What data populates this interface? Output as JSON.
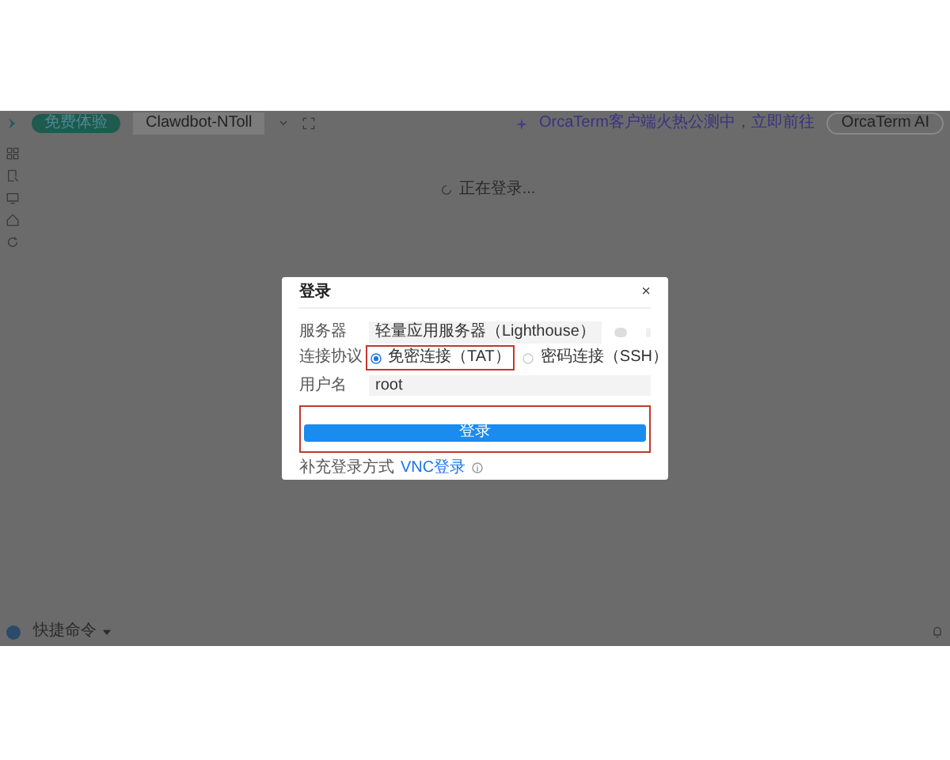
{
  "top_bar": {
    "badge": "免费体验",
    "tabs": [
      {
        "label": "Clawdbot-NToll",
        "selected": true
      }
    ],
    "promo": "OrcaTerm客户端火热公测中，立即前往",
    "ai_button": "OrcaTerm AI"
  },
  "loading": "正在登录...",
  "dialog": {
    "title": "登录",
    "close": "×",
    "server": {
      "label": "服务器",
      "value": "轻量应用服务器（Lighthouse）"
    },
    "protocol": {
      "label": "连接协议",
      "options": [
        {
          "label": "免密连接（TAT）",
          "selected": true
        },
        {
          "label": "密码连接（SSH）",
          "selected": false
        }
      ]
    },
    "username": {
      "label": "用户名",
      "value": "root"
    },
    "submit": "登录",
    "extra": {
      "label": "补充登录方式",
      "link": "VNC登录"
    }
  },
  "bottom_bar": {
    "quick_commands": "快捷命令"
  }
}
